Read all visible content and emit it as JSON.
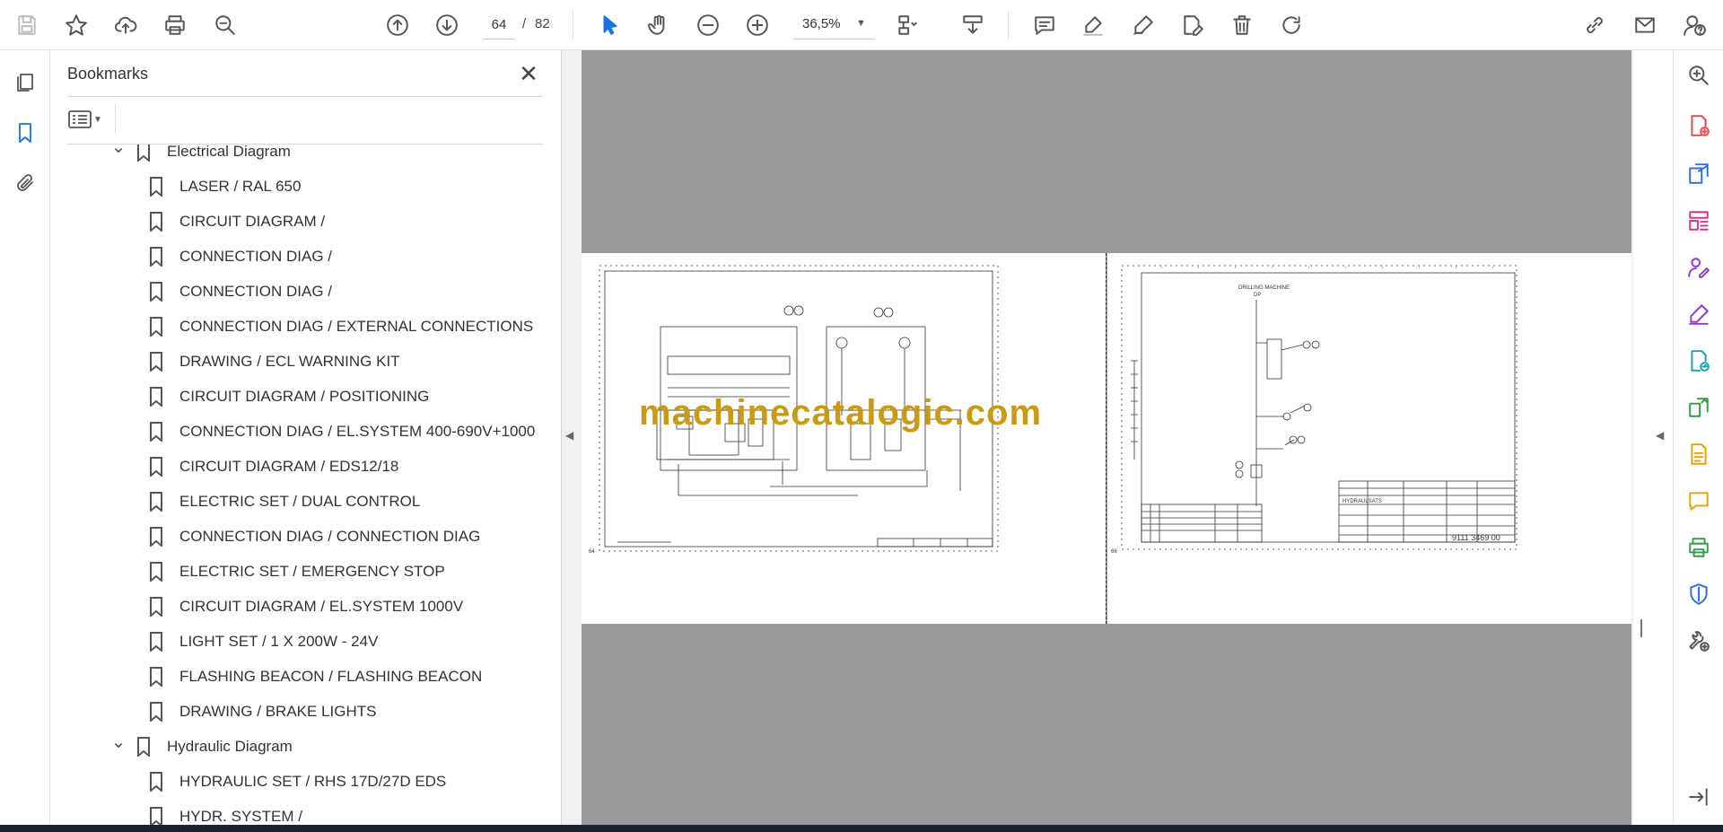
{
  "toolbar": {
    "tools": [
      {
        "icon": "save-icon"
      },
      {
        "icon": "star-icon"
      },
      {
        "icon": "upload-icon"
      },
      {
        "icon": "print-icon"
      },
      {
        "icon": "zoom-search-icon"
      },
      {
        "icon": "page-up-icon"
      },
      {
        "icon": "page-down-icon"
      },
      {
        "icon": "select-arrow-icon"
      },
      {
        "icon": "hand-icon"
      },
      {
        "icon": "zoom-out-icon"
      },
      {
        "icon": "zoom-in-icon"
      },
      {
        "icon": "page-fit-icon"
      },
      {
        "icon": "scroll-mode-icon"
      },
      {
        "icon": "comment-icon"
      },
      {
        "icon": "highlight-icon"
      },
      {
        "icon": "draw-icon"
      },
      {
        "icon": "edit-text-icon"
      },
      {
        "icon": "delete-icon"
      },
      {
        "icon": "rotate-icon"
      },
      {
        "icon": "link-icon"
      },
      {
        "icon": "mail-icon"
      },
      {
        "icon": "user-help-icon"
      }
    ],
    "current_page": "64",
    "page_separator": "/",
    "total_pages": "82",
    "zoom": "36,5%"
  },
  "bookmarks": {
    "title": "Bookmarks",
    "items": [
      {
        "label": "Electrical Diagram",
        "level": 0,
        "expanded": true
      },
      {
        "label": "LASER / RAL 650",
        "level": 1
      },
      {
        "label": "CIRCUIT DIAGRAM /",
        "level": 1
      },
      {
        "label": "CONNECTION DIAG /",
        "level": 1
      },
      {
        "label": "CONNECTION DIAG /",
        "level": 1
      },
      {
        "label": "CONNECTION DIAG / EXTERNAL CONNECTIONS",
        "level": 1
      },
      {
        "label": "DRAWING / ECL WARNING KIT",
        "level": 1
      },
      {
        "label": "CIRCUIT DIAGRAM / POSITIONING",
        "level": 1
      },
      {
        "label": "CONNECTION DIAG / EL.SYSTEM 400-690V+1000V",
        "level": 1
      },
      {
        "label": "CIRCUIT DIAGRAM / EDS12/18",
        "level": 1
      },
      {
        "label": "ELECTRIC SET / DUAL CONTROL",
        "level": 1
      },
      {
        "label": "CONNECTION DIAG / CONNECTION DIAG",
        "level": 1
      },
      {
        "label": "ELECTRIC SET / EMERGENCY STOP",
        "level": 1
      },
      {
        "label": "CIRCUIT DIAGRAM / EL.SYSTEM 1000V",
        "level": 1
      },
      {
        "label": "LIGHT SET / 1 X 200W - 24V",
        "level": 1
      },
      {
        "label": "FLASHING BEACON / FLASHING BEACON",
        "level": 1
      },
      {
        "label": "DRAWING / BRAKE LIGHTS",
        "level": 1
      },
      {
        "label": "Hydraulic Diagram",
        "level": 0,
        "expanded": true
      },
      {
        "label": "HYDRAULIC SET / RHS 17D/27D EDS",
        "level": 1
      },
      {
        "label": "HYDR. SYSTEM /",
        "level": 1
      }
    ]
  },
  "document": {
    "watermark": "machinecatalogic.com",
    "left_page": {
      "page_label": "64"
    },
    "right_page": {
      "page_label": "66",
      "header_text": "DRILLING MACHINE",
      "header_sub": "DP",
      "title_block_text": "HYDRAULSATS",
      "drawing_number": "9111 3469 00"
    }
  }
}
